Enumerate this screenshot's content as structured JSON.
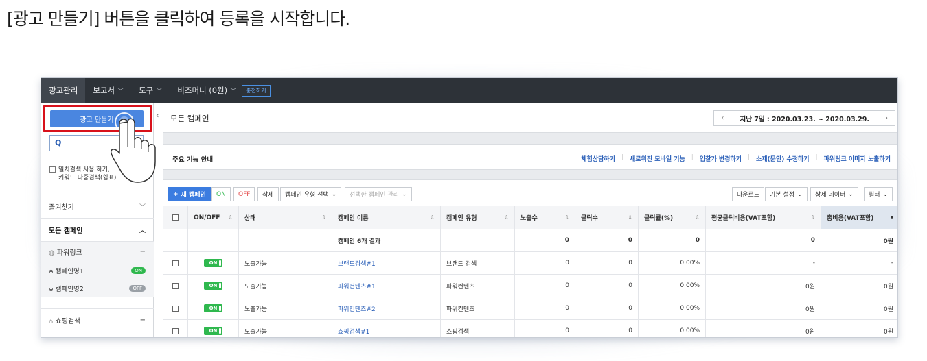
{
  "caption": "[광고 만들기] 버튼을 클릭하여 등록을 시작합니다.",
  "topnav": {
    "items": [
      "광고관리",
      "보고서",
      "도구",
      "비즈머니 (0원)"
    ],
    "charge_label": "충전하기"
  },
  "sidebar": {
    "create_label": "광고 만들기",
    "search_placeholder": "",
    "match_option": "일치검색 사용 하기,",
    "match_option_2": "키워드 다중검색(쉼표)",
    "favorites": "즐겨찾기",
    "all_campaigns": "모든 캠페인",
    "powerlink_group": "파워링크",
    "campaigns": [
      {
        "name": "캠페인명1",
        "status": "ON"
      },
      {
        "name": "캠페인명2",
        "status": "OFF"
      }
    ],
    "shopping_group": "쇼핑검색"
  },
  "main": {
    "title": "모든 캠페인",
    "date_range": "지난 7일 : 2020.03.23. ~ 2020.03.29.",
    "guide_title": "주요 기능 안내",
    "guide_links": [
      "체험상담하기",
      "새로워진 모바일 기능",
      "입찰가 변경하기",
      "소재(문안) 수정하기",
      "파워링크 이미지 노출하기"
    ]
  },
  "toolbar": {
    "new_campaign": "새 캠페인",
    "on": "ON",
    "off": "OFF",
    "delete": "삭제",
    "type_select": "캠페인 유형 선택",
    "manage": "선택한 캠페인 관리",
    "download": "다운로드",
    "basic_settings": "기본 설정",
    "detail_data": "상세 데이터",
    "filter": "필터"
  },
  "table": {
    "headers": [
      "ON/OFF",
      "상태",
      "캠페인 이름",
      "캠페인 유형",
      "노출수",
      "클릭수",
      "클릭률(%)",
      "평균클릭비용(VAT포함)",
      "총비용(VAT포함)"
    ],
    "summary": {
      "label": "캠페인 6개 결과",
      "impressions": "0",
      "clicks": "0",
      "ctr": "0",
      "cpc": "0",
      "cost": "0원"
    },
    "rows": [
      {
        "toggle": "ON",
        "status": "노출가능",
        "name": "브랜드검색#1",
        "type": "브랜드 검색",
        "impressions": "0",
        "clicks": "0",
        "ctr": "0.00%",
        "cpc": "-",
        "cost": "-"
      },
      {
        "toggle": "ON",
        "status": "노출가능",
        "name": "파워컨텐츠#1",
        "type": "파워컨텐츠",
        "impressions": "0",
        "clicks": "0",
        "ctr": "0.00%",
        "cpc": "0원",
        "cost": "0원"
      },
      {
        "toggle": "ON",
        "status": "노출가능",
        "name": "파워컨텐츠#2",
        "type": "파워컨텐츠",
        "impressions": "0",
        "clicks": "0",
        "ctr": "0.00%",
        "cpc": "0원",
        "cost": "0원"
      },
      {
        "toggle": "ON",
        "status": "노출가능",
        "name": "쇼핑검색#1",
        "type": "쇼핑검색",
        "impressions": "0",
        "clicks": "0",
        "ctr": "0.00%",
        "cpc": "0원",
        "cost": "0원"
      }
    ]
  },
  "colors": {
    "accent": "#4a86e0",
    "highlight": "#d8111b",
    "on": "#2fb84e",
    "nav": "#2d3238"
  }
}
